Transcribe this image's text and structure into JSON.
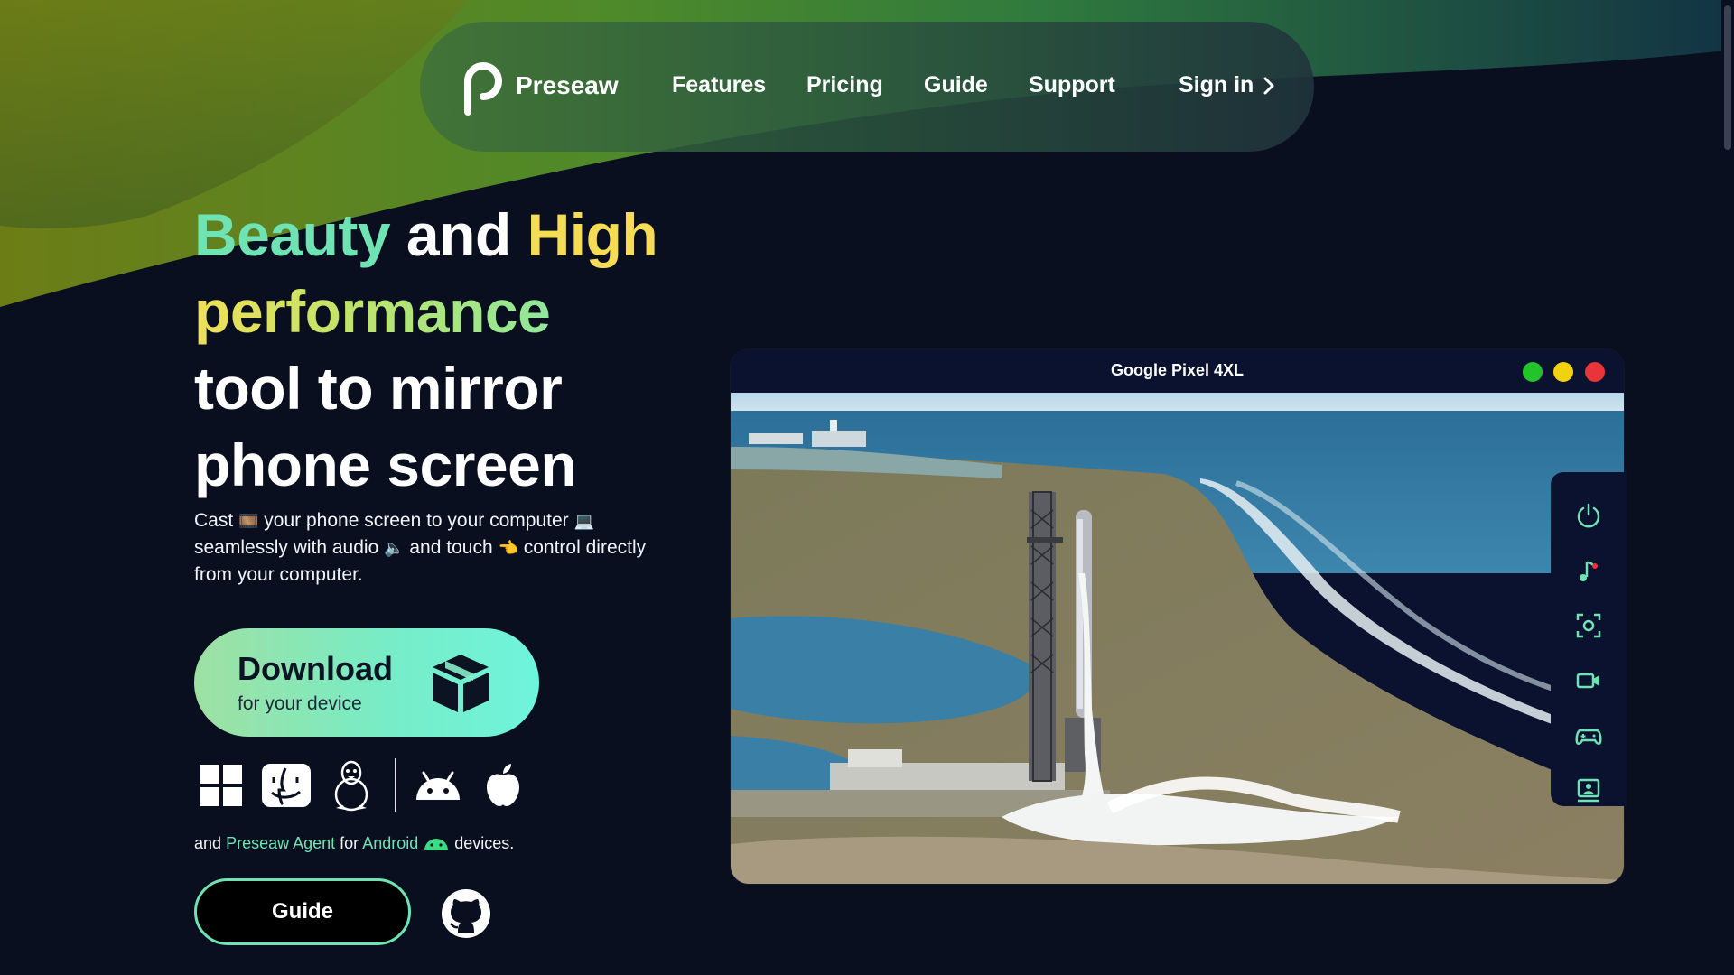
{
  "nav": {
    "brand": "Preseaw",
    "links": [
      "Features",
      "Pricing",
      "Guide",
      "Support"
    ],
    "sign_in": "Sign in"
  },
  "hero": {
    "title_word1": "Beauty",
    "title_word2": "and",
    "title_word3": "High",
    "title_word4": "performance",
    "title_line3": "tool to mirror",
    "title_line4": "phone screen",
    "desc_part1": "Cast",
    "desc_part2": "your phone screen to your computer",
    "desc_part3": "seamlessly with audio",
    "desc_part4": "and touch",
    "desc_part5": "control directly from your computer.",
    "emojis": [
      "🎞️",
      "💻",
      "🔈",
      "👈"
    ]
  },
  "download": {
    "title": "Download",
    "subtitle": "for your device"
  },
  "platforms": [
    "windows-icon",
    "finder-icon",
    "linux-icon",
    "android-icon",
    "apple-icon"
  ],
  "agent_line": {
    "part1": "and",
    "link1": "Preseaw Agent",
    "part2": "for",
    "link2": "Android",
    "part3": "devices."
  },
  "guide_button": "Guide",
  "window": {
    "title": "Google Pixel 4XL",
    "dot_colors": [
      "#22c42a",
      "#f2d20d",
      "#e8343a"
    ]
  },
  "tools": [
    "power-icon",
    "music-icon",
    "screenshot-icon",
    "record-icon",
    "gamepad-icon",
    "screen-icon"
  ],
  "colors": {
    "accent_mint": "#6fe3b4",
    "accent_yellow": "#f5dc55",
    "background": "#0a0f1f"
  }
}
